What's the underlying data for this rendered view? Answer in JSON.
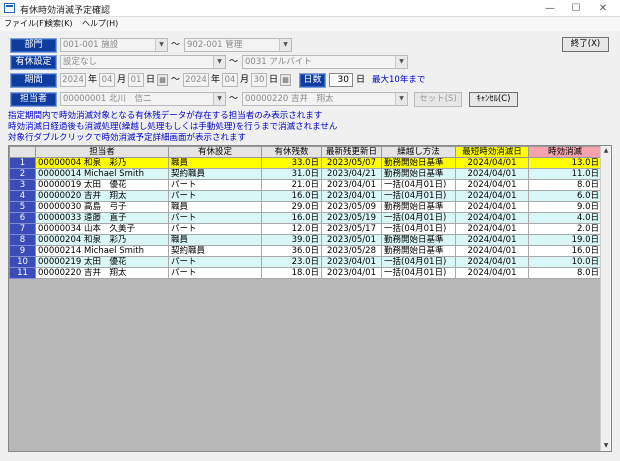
{
  "window": {
    "title": "有休時効消滅予定確認",
    "min": "—",
    "max": "☐",
    "close": "✕"
  },
  "menu": [
    "ファイル(F)",
    "検索(K)",
    "ヘルプ(H)"
  ],
  "form": {
    "dept_label": "部門",
    "dept_from": "001-001 施設",
    "dept_to": "902-001 管理",
    "yukyu_label": "有休設定",
    "yukyu_from": "設定なし",
    "yukyu_to": "0031 アルバイト",
    "period_label": "期間",
    "from_year": "2024",
    "from_month": "04",
    "from_day": "01",
    "to_year": "2024",
    "to_month": "04",
    "to_day": "30",
    "year_char": "年",
    "month_char": "月",
    "day_char": "日",
    "days_label": "日数",
    "days_value": "30",
    "days_unit": "日",
    "max_note": "最大10年まで",
    "person_label": "担当者",
    "person_from": "00000001 北川　信二",
    "person_to": "00000220 吉井　翔太",
    "tilde": "～",
    "set_button": "セット(S)",
    "cancel_button": "ｷｬﾝｾﾙ(C)",
    "exit_button": "終了(X)"
  },
  "notices": [
    "指定期間内で時効消滅対象となる有休残データが存在する担当者のみ表示されます",
    "時効消滅日経過後も消滅処理(繰越し処理もしくは手動処理)を行うまで消滅されません",
    "対象行ダブルクリックで時効消滅予定詳細画面が表示されます"
  ],
  "table": {
    "headers": [
      "担当者",
      "有休設定",
      "有休残数",
      "最新残更新日",
      "繰越し方法",
      "最短時効消滅日",
      "時効消滅"
    ],
    "rows": [
      [
        "1",
        "00000004 和泉　彩乃",
        "職員",
        "33.0日",
        "2023/05/07",
        "勤務開始日基準",
        "2024/04/01",
        "13.0日"
      ],
      [
        "2",
        "00000014 Michael Smith",
        "契約職員",
        "31.0日",
        "2023/04/21",
        "勤務開始日基準",
        "2024/04/01",
        "11.0日"
      ],
      [
        "3",
        "00000019 太田　優花",
        "パート",
        "21.0日",
        "2023/04/01",
        "一括(04月01日)",
        "2024/04/01",
        "8.0日"
      ],
      [
        "4",
        "00000020 吉井　翔太",
        "パート",
        "16.0日",
        "2023/04/01",
        "一括(04月01日)",
        "2024/04/01",
        "6.0日"
      ],
      [
        "5",
        "00000030 高島　弓子",
        "職員",
        "29.0日",
        "2023/05/09",
        "勤務開始日基準",
        "2024/04/01",
        "9.0日"
      ],
      [
        "6",
        "00000033 遠藤　直子",
        "パート",
        "16.0日",
        "2023/05/19",
        "一括(04月01日)",
        "2024/04/01",
        "4.0日"
      ],
      [
        "7",
        "00000034 山本　久美子",
        "パート",
        "12.0日",
        "2023/05/17",
        "一括(04月01日)",
        "2024/04/01",
        "2.0日"
      ],
      [
        "8",
        "00000204 和泉　彩乃",
        "職員",
        "39.0日",
        "2023/05/01",
        "勤務開始日基準",
        "2024/04/01",
        "19.0日"
      ],
      [
        "9",
        "00000214 Michael Smith",
        "契約職員",
        "36.0日",
        "2023/05/28",
        "勤務開始日基準",
        "2024/04/01",
        "16.0日"
      ],
      [
        "10",
        "00000219 太田　優花",
        "パート",
        "23.0日",
        "2023/04/01",
        "一括(04月01日)",
        "2024/04/01",
        "10.0日"
      ],
      [
        "11",
        "00000220 吉井　翔太",
        "パート",
        "18.0日",
        "2023/04/01",
        "一括(04月01日)",
        "2024/04/01",
        "8.0日"
      ]
    ]
  },
  "icons": {
    "dropdown": "▼",
    "calendar": "▦",
    "scroll_up": "▲",
    "scroll_down": "▼"
  },
  "colors": {
    "label_bg": "#0f3c9e",
    "notice_text": "#0000cc",
    "selected_row": "#ffff00",
    "alt_row": "#d9f7f7",
    "row_header": "#3a4cb8",
    "expire_header": "#f4a2ad"
  }
}
